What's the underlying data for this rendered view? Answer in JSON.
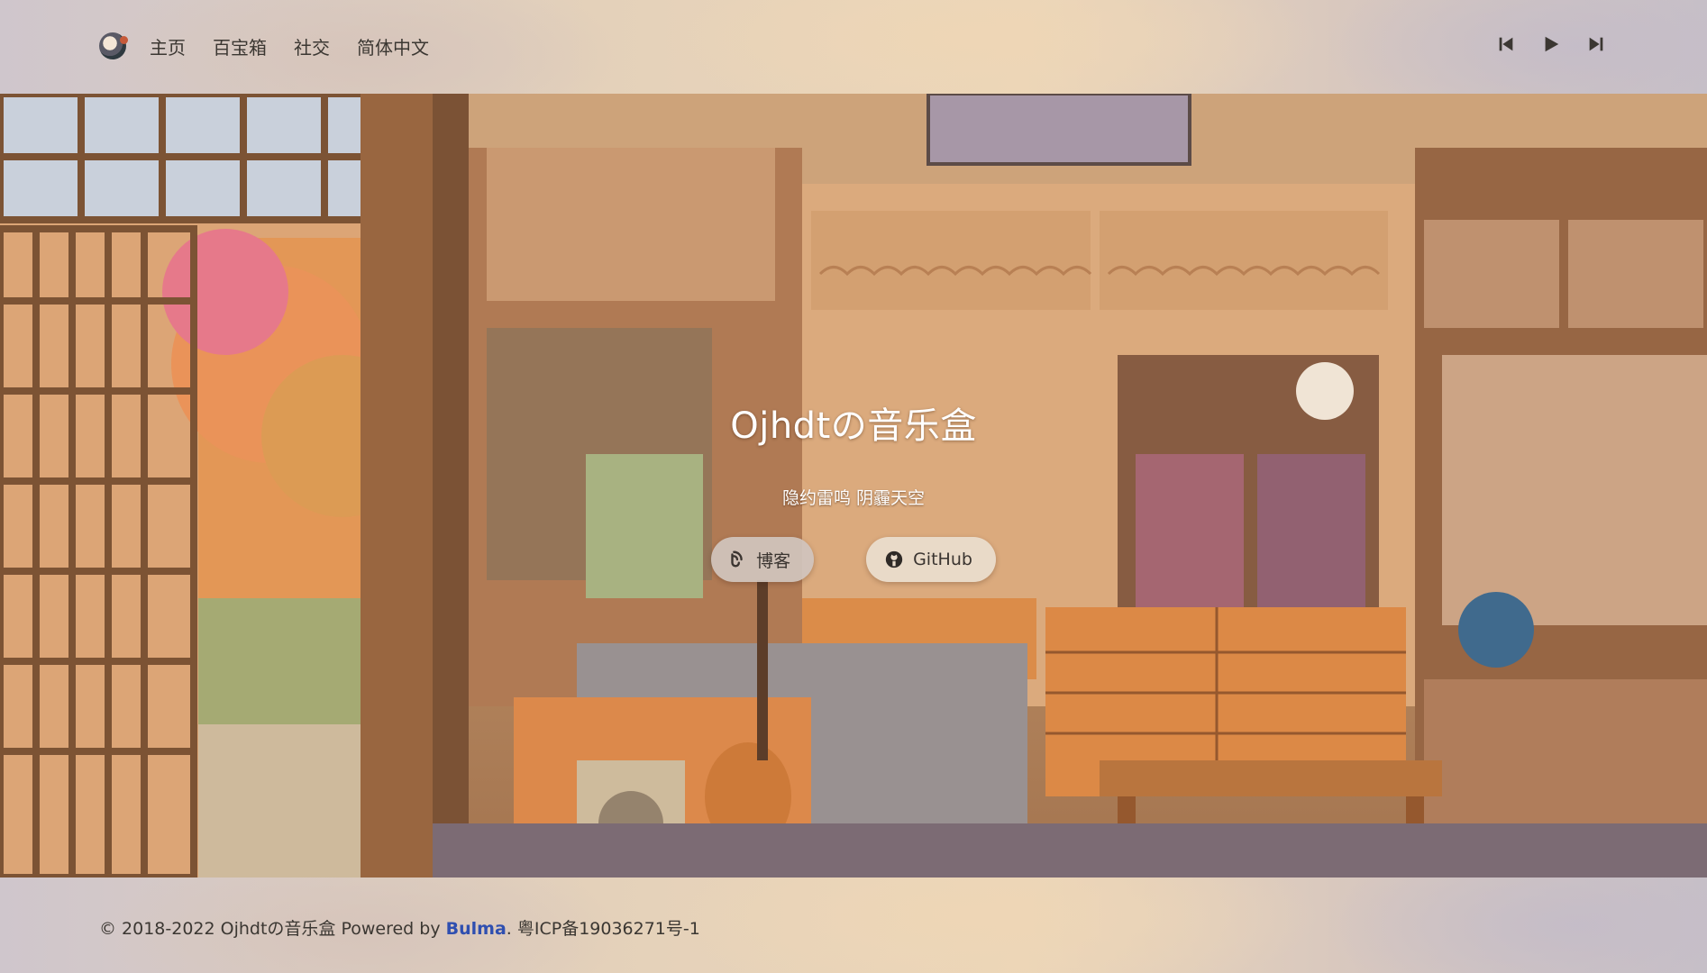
{
  "header": {
    "logo_icon": "cat-avatar-icon",
    "nav": [
      {
        "label": "主页"
      },
      {
        "label": "百宝箱"
      },
      {
        "label": "社交"
      },
      {
        "label": "简体中文"
      }
    ],
    "player": {
      "prev_icon": "skip-previous-icon",
      "play_icon": "play-icon",
      "next_icon": "skip-next-icon"
    }
  },
  "hero": {
    "title": "Ojhdtの音乐盒",
    "subtitle": "隐约雷鸣 阴霾天空",
    "buttons": [
      {
        "label": "博客",
        "icon": "blog-icon"
      },
      {
        "label": "GitHub",
        "icon": "github-icon"
      }
    ]
  },
  "footer": {
    "copyright": "© 2018-2022 Ojhdtの音乐盒 Powered by ",
    "bulma_link": "Bulma",
    "icp": ". 粤ICP备19036271号-1"
  },
  "colors": {
    "nav_text": "#3b3732",
    "bulma_link": "#2f4fb0",
    "hero_text": "#ffffff"
  }
}
